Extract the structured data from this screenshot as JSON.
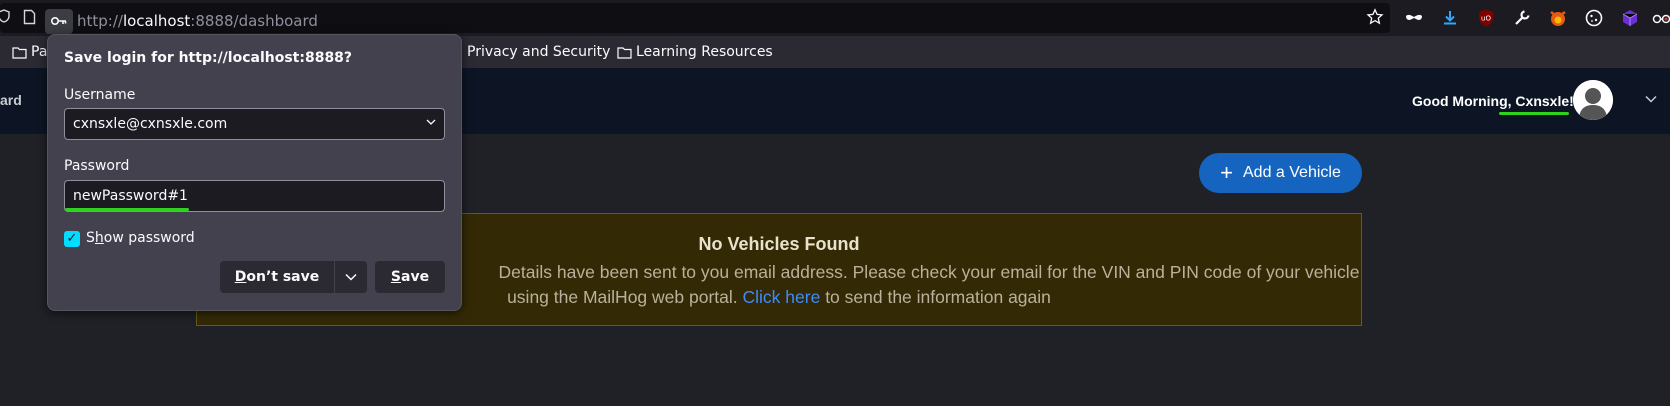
{
  "browser": {
    "url_prefix": "http://",
    "url_host": "localhost",
    "url_path": ":8888/dashboard",
    "bookmarks": [
      {
        "label": "Pa"
      },
      {
        "label": "Privacy and Security"
      },
      {
        "label": "Learning Resources"
      }
    ],
    "extensions": [
      "incognito-mask-icon",
      "download-icon",
      "ublock-icon",
      "wrench-icon",
      "firefox-fox-icon",
      "cookie-icon",
      "purple-cube-icon",
      "glasses-icon"
    ]
  },
  "app": {
    "nav_left_text": "ard",
    "greeting": "Good Morning, Cxnsxle!",
    "add_vehicle_label": "Add a Vehicle",
    "alert": {
      "title": "No Vehicles Found",
      "line1": "Details have been sent to you email address. Please check your email for the VIN and PIN code of your vehicle",
      "line2_before": "using the MailHog web portal.",
      "link_text": "Click here",
      "line2_after": "to send the information again"
    }
  },
  "doorhanger": {
    "title": "Save login for http://localhost:8888?",
    "username_label": "Username",
    "username_value": "cxnsxle@cxnsxle.com",
    "password_label": "Password",
    "password_value": "newPassword#1",
    "show_password_pre": "S",
    "show_password_accel": "h",
    "show_password_post": "ow password",
    "show_password_checked": true,
    "dont_save_accel": "D",
    "dont_save_rest": "on’t save",
    "save_accel": "S",
    "save_rest": "ave"
  },
  "colors": {
    "accent_green": "#2fd21e",
    "primary_button": "#1565c0",
    "alert_background": "#332a05",
    "link": "#3d8bfd"
  }
}
